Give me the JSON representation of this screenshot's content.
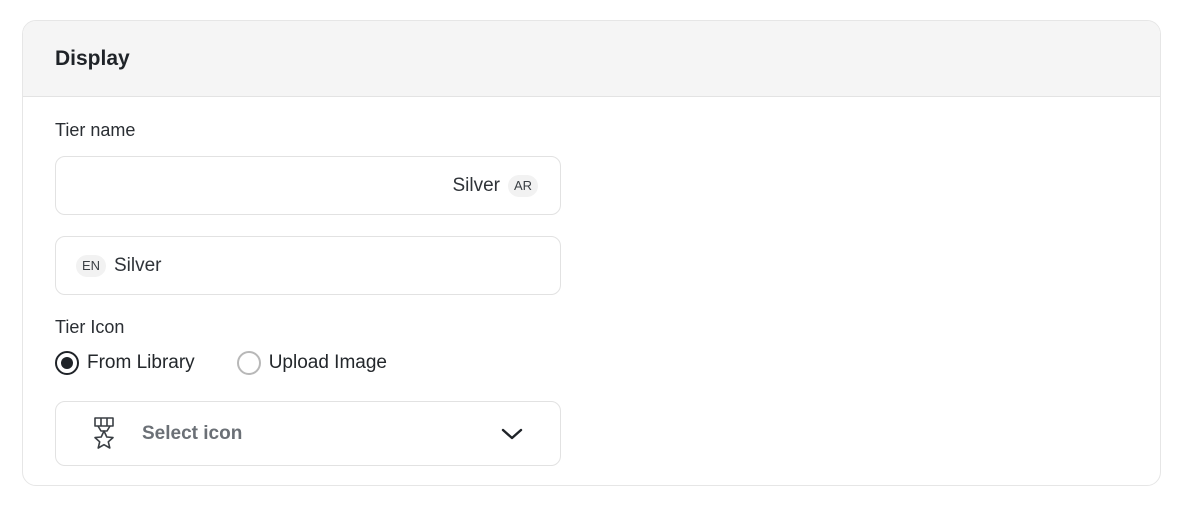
{
  "section": {
    "title": "Display"
  },
  "tier_name": {
    "label": "Tier name",
    "ar": {
      "value": "Silver",
      "lang": "AR"
    },
    "en": {
      "value": "Silver",
      "lang": "EN"
    }
  },
  "tier_icon": {
    "label": "Tier Icon",
    "options": [
      {
        "label": "From Library",
        "checked": true
      },
      {
        "label": "Upload Image",
        "checked": false
      }
    ],
    "select": {
      "placeholder": "Select icon",
      "icon": "medal-icon"
    }
  }
}
